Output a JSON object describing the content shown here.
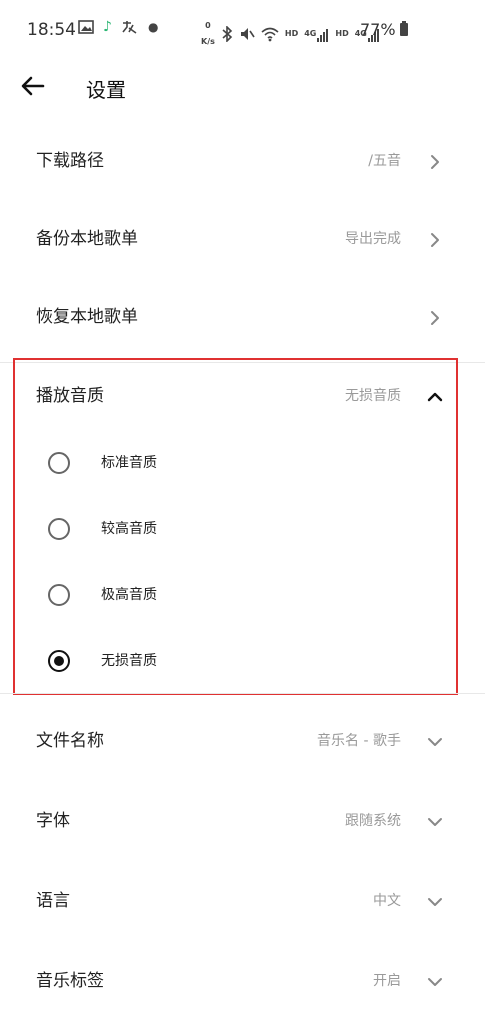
{
  "status_bar": {
    "time": "18:54",
    "net_speed_top": "0",
    "net_speed_unit": "K/s",
    "hd1": "HD",
    "g1": "4G",
    "hd2": "HD",
    "g2": "4G",
    "battery": "77%"
  },
  "header": {
    "title": "设置"
  },
  "rows": [
    {
      "label": "下载路径",
      "value": "/五音"
    },
    {
      "label": "备份本地歌单",
      "value": "导出完成"
    },
    {
      "label": "恢复本地歌单",
      "value": ""
    },
    {
      "label": "播放音质",
      "value": "无损音质"
    },
    {
      "label": "文件名称",
      "value": "音乐名 - 歌手"
    },
    {
      "label": "字体",
      "value": "跟随系统"
    },
    {
      "label": "语言",
      "value": "中文"
    },
    {
      "label": "音乐标签",
      "value": "开启"
    }
  ],
  "quality_options": [
    {
      "label": "标准音质",
      "selected": false
    },
    {
      "label": "较高音质",
      "selected": false
    },
    {
      "label": "极高音质",
      "selected": false
    },
    {
      "label": "无损音质",
      "selected": true
    }
  ],
  "colors": {
    "highlight": "#e03131",
    "value_text": "#9a9a9a"
  }
}
